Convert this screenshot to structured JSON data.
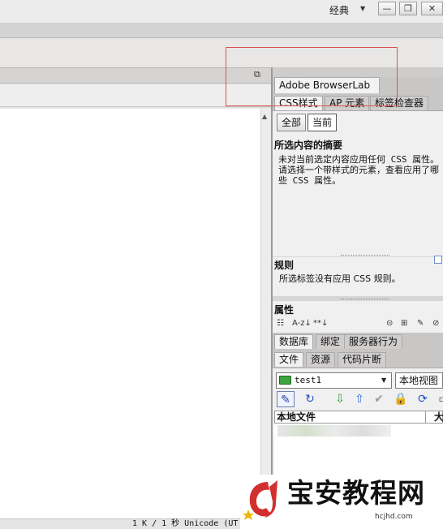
{
  "titlebar": {
    "workspace_label": "经典",
    "workspace_arrow": "▼",
    "minimize_glyph": "—",
    "maximize_glyph": "❐",
    "close_glyph": "✕"
  },
  "document": {
    "restore_glyph": "⧉",
    "scroll_up_glyph": "▲",
    "status_text": "1 K / 1 秒  Unicode (UT"
  },
  "right_panel": {
    "browserlab_tab": "Adobe BrowserLab",
    "css_tabs": [
      "CSS样式",
      "AP 元素",
      "标签检查器"
    ],
    "segments": [
      "全部",
      "当前"
    ],
    "summary": {
      "heading": "所选内容的摘要",
      "text": "未对当前选定内容应用任何 CSS 属性。请选择一个带样式的元素，查看应用了哪些 CSS 属性。"
    },
    "rules": {
      "heading": "规则",
      "text": "所选标签没有应用 CSS 规则。"
    },
    "properties": {
      "heading": "属性",
      "toolbar": [
        "☷",
        "A-z↓",
        "**↓",
        "⊝",
        "⊞",
        "✎",
        "⊘"
      ]
    },
    "db_tabs": [
      "数据库",
      "绑定",
      "服务器行为"
    ],
    "file_tabs": [
      "文件",
      "资源",
      "代码片断"
    ],
    "site_select": "test1",
    "view_select": "本地视图",
    "file_toolbar": {
      "connect": "✎",
      "refresh": "↻",
      "get": "⇩",
      "put": "⇧",
      "checkout": "✔",
      "checkin": "🔒",
      "sync": "⟳",
      "expand": "▭"
    },
    "columns": {
      "local": "本地文件",
      "size": "大"
    }
  },
  "watermark": {
    "title": "宝安教程网",
    "url": "hcjhd.com"
  },
  "colors": {
    "highlight": "#d9534f",
    "watermark_logo": "#d32f2f"
  }
}
